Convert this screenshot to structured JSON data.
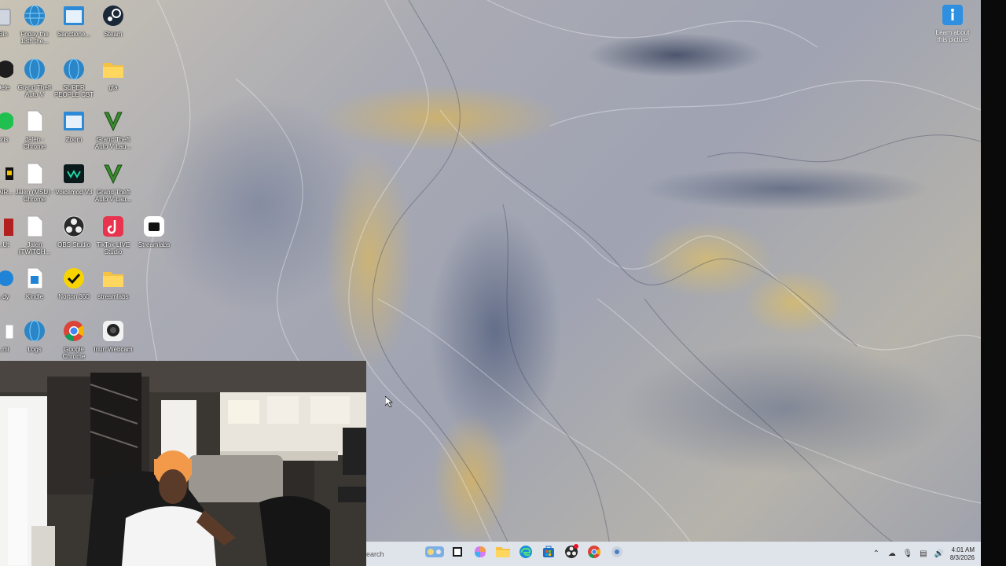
{
  "desktop_icons": [
    {
      "id": "bin",
      "label": "Bin",
      "icon": "recycle-bin-icon"
    },
    {
      "id": "friday",
      "label": "Friday the 13th the...",
      "icon": "globe-icon"
    },
    {
      "id": "sanctioned",
      "label": "Sanctione...",
      "icon": "app-window-icon"
    },
    {
      "id": "steam",
      "label": "Steam",
      "icon": "steam-icon"
    },
    {
      "id": "cut2",
      "label": "Dele",
      "icon": "app-icon"
    },
    {
      "id": "gta",
      "label": "Grand Theft Auto V",
      "icon": "globe-icon"
    },
    {
      "id": "superpeople",
      "label": "SUPER PEOPLE CBT",
      "icon": "globe-icon"
    },
    {
      "id": "folder1",
      "label": "gta",
      "icon": "folder-icon"
    },
    {
      "id": "cut3",
      "label": "orts",
      "icon": "app-icon"
    },
    {
      "id": "jalen-chrome",
      "label": "Jalen - Chrome",
      "icon": "file-icon"
    },
    {
      "id": "zoom",
      "label": "Zoom",
      "icon": "zoom-icon"
    },
    {
      "id": "gta2",
      "label": "Grand Theft Auto V Lau...",
      "icon": "gta-v-icon"
    },
    {
      "id": "cut4",
      "label": "HAIR...",
      "icon": "app-icon"
    },
    {
      "id": "jalen-msu",
      "label": "Jalen (MSU) - Chrome",
      "icon": "file-icon"
    },
    {
      "id": "voicemod",
      "label": "Voicemod V3",
      "icon": "voicemod-icon"
    },
    {
      "id": "gta3",
      "label": "Grand Theft Auto V Lau...",
      "icon": "gta-v-icon"
    },
    {
      "id": "cut5",
      "label": "...Ut",
      "icon": "app-icon"
    },
    {
      "id": "jalen-twitch",
      "label": "Jalen (TWITCH...",
      "icon": "file-icon"
    },
    {
      "id": "obs",
      "label": "OBS Studio",
      "icon": "obs-icon"
    },
    {
      "id": "tiktok",
      "label": "TikTok LIVE Studio",
      "icon": "tiktok-icon"
    },
    {
      "id": "streamlabs",
      "label": "Streamlabs",
      "icon": "streamlabs-icon"
    },
    {
      "id": "cut6",
      "label": "...dy",
      "icon": "app-icon"
    },
    {
      "id": "kindle",
      "label": "Kindle",
      "icon": "kindle-icon"
    },
    {
      "id": "norton",
      "label": "Norton 360",
      "icon": "norton-icon"
    },
    {
      "id": "streamlabs-folder",
      "label": "streamlabs",
      "icon": "folder-icon"
    },
    {
      "id": "cut7",
      "label": "...mi",
      "icon": "app-icon"
    },
    {
      "id": "logs",
      "label": "Logs",
      "icon": "globe-icon"
    },
    {
      "id": "google-chrome",
      "label": "Google Chrome",
      "icon": "chrome-icon"
    },
    {
      "id": "iriun",
      "label": "Iriun Webcam",
      "icon": "webcam-icon"
    }
  ],
  "learn_picture": {
    "label": "Learn about this picture",
    "icon": "info-icon"
  },
  "taskbar": {
    "search_placeholder": "earch",
    "apps": [
      "widgets-icon",
      "task-view-icon",
      "copilot-icon",
      "file-explorer-icon",
      "edge-icon",
      "store-icon",
      "obs-icon",
      "chrome-icon",
      "settings-icon"
    ]
  },
  "tray": {
    "time": "4:01 AM",
    "date": "8/3/2026"
  },
  "colors": {
    "taskbar_bg": "#dfe3ea",
    "accent": "#0078d4"
  }
}
